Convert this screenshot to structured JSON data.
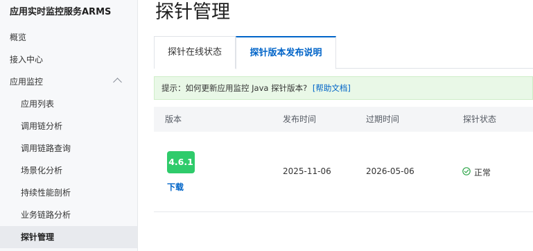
{
  "sidebar": {
    "title": "应用实时监控服务ARMS",
    "items": [
      {
        "label": "概览"
      },
      {
        "label": "接入中心"
      },
      {
        "label": "应用监控"
      }
    ],
    "sub_items": [
      {
        "label": "应用列表"
      },
      {
        "label": "调用链分析"
      },
      {
        "label": "调用链路查询"
      },
      {
        "label": "场景化分析"
      },
      {
        "label": "持续性能剖析"
      },
      {
        "label": "业务链路分析"
      },
      {
        "label": "探针管理"
      }
    ],
    "active_item": "探针管理"
  },
  "main": {
    "title": "探针管理",
    "tabs": [
      {
        "label": "探针在线状态",
        "active": false
      },
      {
        "label": "探针版本发布说明",
        "active": true
      }
    ],
    "tip": {
      "text": "提示：如何更新应用监控 Java 探针版本?",
      "link": "[帮助文档]"
    },
    "table": {
      "headers": [
        "版本",
        "发布时间",
        "过期时间",
        "探针状态"
      ],
      "rows": [
        {
          "version": "4.6.1",
          "download": "下载",
          "release_date": "2025-11-06",
          "expire_date": "2026-05-06",
          "status": "正常"
        }
      ]
    }
  },
  "colors": {
    "accent": "#0064c8",
    "badge_green": "#2fcb6b",
    "tip_background": "#e9f8e7",
    "status_ok": "#2fa64a"
  },
  "icons": {
    "collapse": "chevron-up-icon",
    "status": "check-circle-icon"
  }
}
